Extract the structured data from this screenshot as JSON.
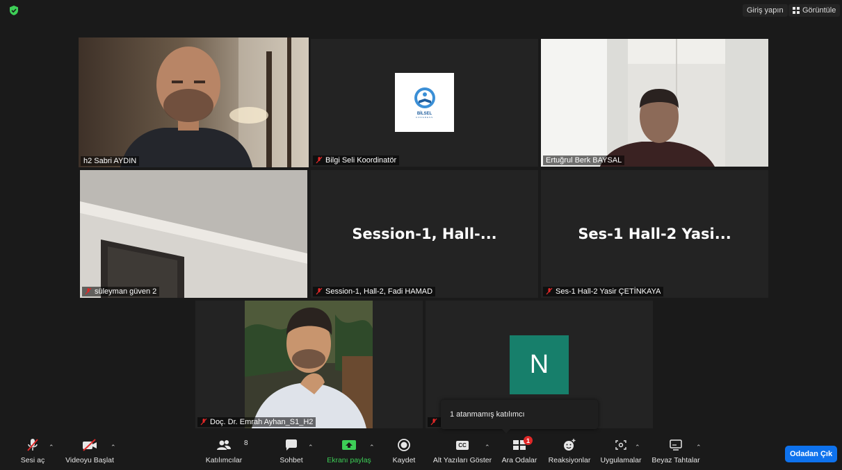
{
  "top": {
    "signin": "Giriş yapın",
    "view": "Görüntüle"
  },
  "tiles": {
    "t1": {
      "name": "h2 Sabri AYDIN"
    },
    "t2": {
      "name": "Bilgi Seli Koordinatör",
      "logo_text": "BİLSEL",
      "logo_sub": "CONGRESS"
    },
    "t3": {
      "name": "Ertuğrul Berk BAYSAL"
    },
    "t4": {
      "name": "süleyman güven 2"
    },
    "t5": {
      "name": "Session-1, Hall-2, Fadi HAMAD",
      "big": "Session-1,  Hall-..."
    },
    "t6": {
      "name": "Ses-1 Hall-2 Yasir ÇETİNKAYA",
      "big": "Ses-1  Hall-2  Yasi..."
    },
    "t7": {
      "name": "Doç. Dr. Emrah Ayhan_S1_H2"
    },
    "t8": {
      "name": "I",
      "avatar_letter": "N",
      "avatar_color": "#177f6b"
    }
  },
  "tooltip": "1 atanmamış katılımcı",
  "toolbar": {
    "mute": "Sesi aç",
    "video": "Videoyu Başlat",
    "participants": "Katılımcılar",
    "participants_count": "8",
    "chat": "Sohbet",
    "share": "Ekranı paylaş",
    "record": "Kaydet",
    "captions": "Alt Yazıları Göster",
    "captions_icon": "CC",
    "breakout": "Ara Odalar",
    "breakout_badge": "1",
    "reactions": "Reaksiyonlar",
    "apps": "Uygulamalar",
    "whiteboard": "Beyaz Tahtalar",
    "leave": "Odadan Çık"
  },
  "colors": {
    "accent": "#0e72ed",
    "speaker_border": "#c7e069",
    "share_green": "#3dcf57",
    "mute_red": "#e02828"
  }
}
